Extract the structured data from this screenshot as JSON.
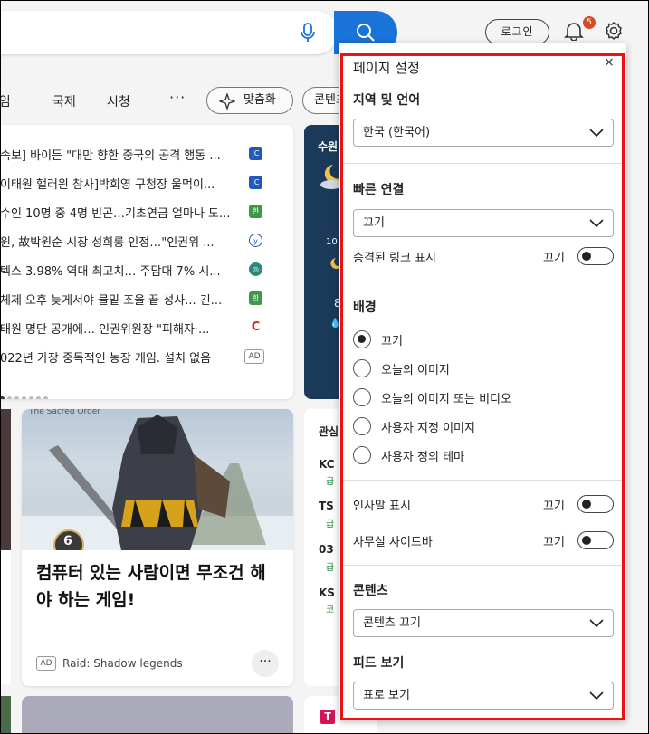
{
  "header": {
    "login_label": "로그인",
    "notification_count": "5"
  },
  "nav": {
    "items": [
      "게임",
      "국제",
      "시청"
    ],
    "more": "···",
    "customize_label": "맞춤화",
    "content_label": "콘텐츠"
  },
  "news": {
    "items": [
      {
        "text": "속보] 바이든 \"대만 향한 중국의 공격 행동 ...",
        "source_icon": "news-source-icon"
      },
      {
        "text": "이태원 핼러윈 참사]박희영 구청장 울먹이...",
        "source_icon": "news-source-icon"
      },
      {
        "text": "수인 10명 중 4명 빈곤…기초연금 얼마나 도...",
        "source_icon": "news-source-icon"
      },
      {
        "text": "원, 故박원순 시장 성희롱 인정…\"인권위 ...",
        "source_icon": "news-source-icon"
      },
      {
        "text": "텍스 3.98% 역대 최고치… 주담대 7% 시...",
        "source_icon": "news-source-icon"
      },
      {
        "text": "체제 오후 늦게서야 물밑 조율 끝 성사... 긴...",
        "source_icon": "news-source-icon"
      },
      {
        "text": "태원 명단 공개에… 인권위원장 \"피해자·...",
        "source_icon": "news-source-icon"
      },
      {
        "text": "022년 가장 중독적인 농장 게임. 설치 없음",
        "ad": "AD"
      }
    ]
  },
  "weather": {
    "city": "수원",
    "hour": "10",
    "temp": "8",
    "drop": "💧"
  },
  "game_card": {
    "title": "컴퓨터 있는 사람이면 무조건 해야 하는 게임!",
    "ad": "AD",
    "source": "Raid: Shadow legends",
    "more": "···",
    "level_badge": "6",
    "image_caption": "The Sacred Order"
  },
  "stocks": {
    "title": "관심",
    "rows": [
      {
        "code": "KC",
        "sub": "급"
      },
      {
        "code": "TS",
        "sub": "급"
      },
      {
        "code": "03",
        "sub": "급"
      },
      {
        "code": "KS",
        "sub": "코"
      }
    ]
  },
  "bottom": {
    "t_icon": "T"
  },
  "settings": {
    "title": "페이지 설정",
    "close": "×",
    "region_label": "지역 및 언어",
    "region_value": "한국 (한국어)",
    "quick_links_label": "빠른 연결",
    "quick_links_value": "끄기",
    "promoted_links_label": "승격된 링크 표시",
    "promoted_links_state": "끄기",
    "background_label": "배경",
    "background_options": [
      "끄기",
      "오늘의 이미지",
      "오늘의 이미지 또는 비디오",
      "사용자 지정 이미지",
      "사용자 정의 테마"
    ],
    "greeting_label": "인사말 표시",
    "greeting_state": "끄기",
    "office_sidebar_label": "사무실 사이드바",
    "office_sidebar_state": "끄기",
    "content_label": "콘텐츠",
    "content_value": "콘텐츠 끄기",
    "feed_label": "피드 보기",
    "feed_value": "표로 보기"
  }
}
